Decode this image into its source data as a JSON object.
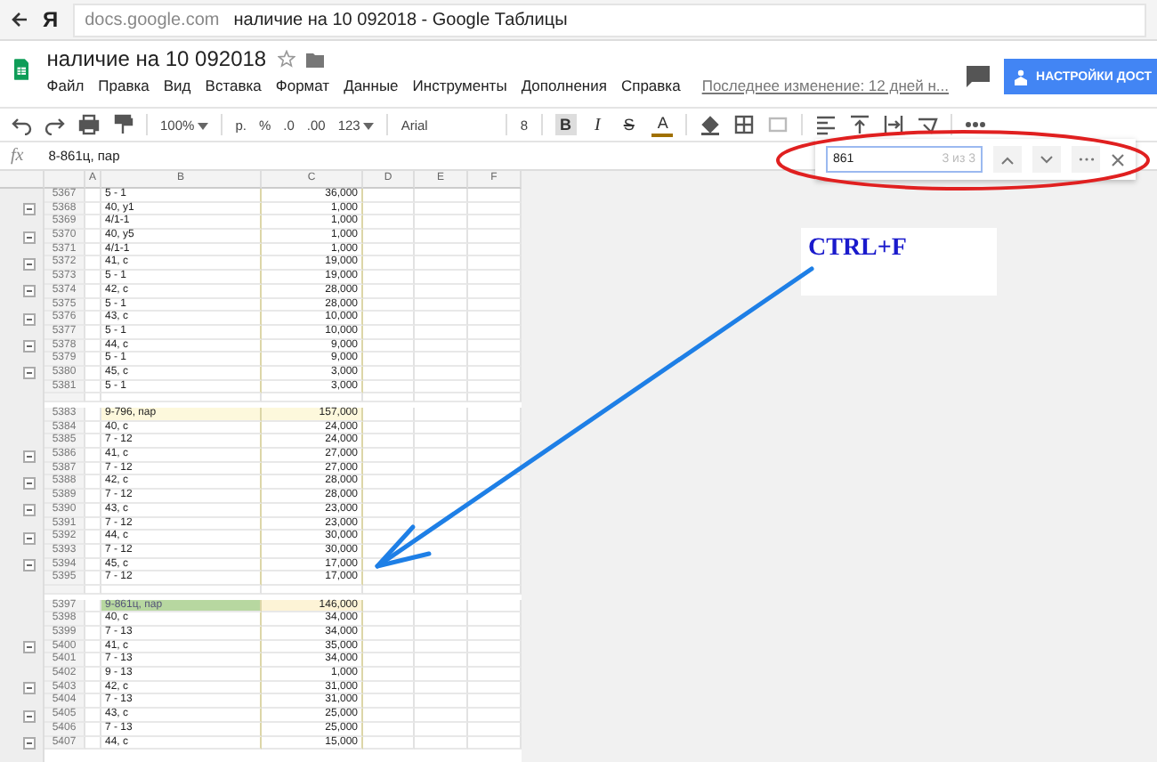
{
  "browser": {
    "logo": "Я",
    "domain": "docs.google.com",
    "page_title": "наличие на 10 092018 - Google Таблицы"
  },
  "document": {
    "title": "наличие на 10 092018",
    "menu": [
      "Файл",
      "Правка",
      "Вид",
      "Вставка",
      "Формат",
      "Данные",
      "Инструменты",
      "Дополнения",
      "Справка"
    ],
    "last_edit": "Последнее изменение: 12 дней н...",
    "share_button": "НАСТРОЙКИ ДОСТ"
  },
  "toolbar": {
    "zoom": "100%",
    "currency": "р.",
    "percent": "%",
    "decrease_decimals": ".0",
    "increase_decimals": ".00",
    "number_format": "123",
    "font": "Arial",
    "font_size": "8",
    "bold": "B",
    "bold_on": true,
    "italic": "I",
    "strike": "S",
    "text_color": "A"
  },
  "formula_bar": {
    "label": "fx",
    "value": "8-861ц, пар"
  },
  "find_bar": {
    "query": "861",
    "count": "3 из 3"
  },
  "annotation": {
    "label": "CTRL+F"
  },
  "sheet": {
    "columns": [
      "A",
      "B",
      "C",
      "D",
      "E",
      "F"
    ],
    "rows": [
      {
        "kind": "data",
        "number": "5367",
        "b": "5 - 1",
        "c": "36,000",
        "toggle": false
      },
      {
        "kind": "data",
        "number": "5368",
        "b": "40, у1",
        "c": "1,000",
        "toggle": true
      },
      {
        "kind": "data",
        "number": "5369",
        "b": "4/1-1",
        "c": "1,000",
        "toggle": false
      },
      {
        "kind": "data",
        "number": "5370",
        "b": "40, у5",
        "c": "1,000",
        "toggle": true
      },
      {
        "kind": "data",
        "number": "5371",
        "b": "4/1-1",
        "c": "1,000",
        "toggle": false
      },
      {
        "kind": "data",
        "number": "5372",
        "b": "41, с",
        "c": "19,000",
        "toggle": true
      },
      {
        "kind": "data",
        "number": "5373",
        "b": "5 - 1",
        "c": "19,000",
        "toggle": false
      },
      {
        "kind": "data",
        "number": "5374",
        "b": "42, с",
        "c": "28,000",
        "toggle": true
      },
      {
        "kind": "data",
        "number": "5375",
        "b": "5 - 1",
        "c": "28,000",
        "toggle": false
      },
      {
        "kind": "data",
        "number": "5376",
        "b": "43, с",
        "c": "10,000",
        "toggle": true
      },
      {
        "kind": "data",
        "number": "5377",
        "b": "5 - 1",
        "c": "10,000",
        "toggle": false
      },
      {
        "kind": "data",
        "number": "5378",
        "b": "44, с",
        "c": "9,000",
        "toggle": true
      },
      {
        "kind": "data",
        "number": "5379",
        "b": "5 - 1",
        "c": "9,000",
        "toggle": false
      },
      {
        "kind": "data",
        "number": "5380",
        "b": "45, с",
        "c": "3,000",
        "toggle": true
      },
      {
        "kind": "data",
        "number": "5381",
        "b": "5 - 1",
        "c": "3,000",
        "toggle": false
      },
      {
        "kind": "gap"
      },
      {
        "kind": "subtotal",
        "number": "5383",
        "b": "9-796, пар",
        "c": "157,000",
        "toggle": false
      },
      {
        "kind": "data",
        "number": "5384",
        "b": "40, с",
        "c": "24,000",
        "toggle": false
      },
      {
        "kind": "data",
        "number": "5385",
        "b": "7 - 12",
        "c": "24,000",
        "toggle": false
      },
      {
        "kind": "data",
        "number": "5386",
        "b": "41, с",
        "c": "27,000",
        "toggle": true
      },
      {
        "kind": "data",
        "number": "5387",
        "b": "7 - 12",
        "c": "27,000",
        "toggle": false
      },
      {
        "kind": "data",
        "number": "5388",
        "b": "42, с",
        "c": "28,000",
        "toggle": true
      },
      {
        "kind": "data",
        "number": "5389",
        "b": "7 - 12",
        "c": "28,000",
        "toggle": false
      },
      {
        "kind": "data",
        "number": "5390",
        "b": "43, с",
        "c": "23,000",
        "toggle": true
      },
      {
        "kind": "data",
        "number": "5391",
        "b": "7 - 12",
        "c": "23,000",
        "toggle": false
      },
      {
        "kind": "data",
        "number": "5392",
        "b": "44, с",
        "c": "30,000",
        "toggle": true
      },
      {
        "kind": "data",
        "number": "5393",
        "b": "7 - 12",
        "c": "30,000",
        "toggle": false
      },
      {
        "kind": "data",
        "number": "5394",
        "b": "45, с",
        "c": "17,000",
        "toggle": true
      },
      {
        "kind": "data",
        "number": "5395",
        "b": "7 - 12",
        "c": "17,000",
        "toggle": false
      },
      {
        "kind": "gap"
      },
      {
        "kind": "match",
        "number": "5397",
        "b": "9-861ц, пар",
        "c": "146,000",
        "toggle": false
      },
      {
        "kind": "data",
        "number": "5398",
        "b": "40, с",
        "c": "34,000",
        "toggle": false
      },
      {
        "kind": "data",
        "number": "5399",
        "b": "7 - 13",
        "c": "34,000",
        "toggle": false
      },
      {
        "kind": "data",
        "number": "5400",
        "b": "41, с",
        "c": "35,000",
        "toggle": true
      },
      {
        "kind": "data",
        "number": "5401",
        "b": "7 - 13",
        "c": "34,000",
        "toggle": false
      },
      {
        "kind": "data",
        "number": "5402",
        "b": "9 - 13",
        "c": "1,000",
        "toggle": false
      },
      {
        "kind": "data",
        "number": "5403",
        "b": "42, с",
        "c": "31,000",
        "toggle": true
      },
      {
        "kind": "data",
        "number": "5404",
        "b": "7 - 13",
        "c": "31,000",
        "toggle": false
      },
      {
        "kind": "data",
        "number": "5405",
        "b": "43, с",
        "c": "25,000",
        "toggle": true
      },
      {
        "kind": "data",
        "number": "5406",
        "b": "7 - 13",
        "c": "25,000",
        "toggle": false
      },
      {
        "kind": "data",
        "number": "5407",
        "b": "44, с",
        "c": "15,000",
        "toggle": true
      }
    ]
  }
}
